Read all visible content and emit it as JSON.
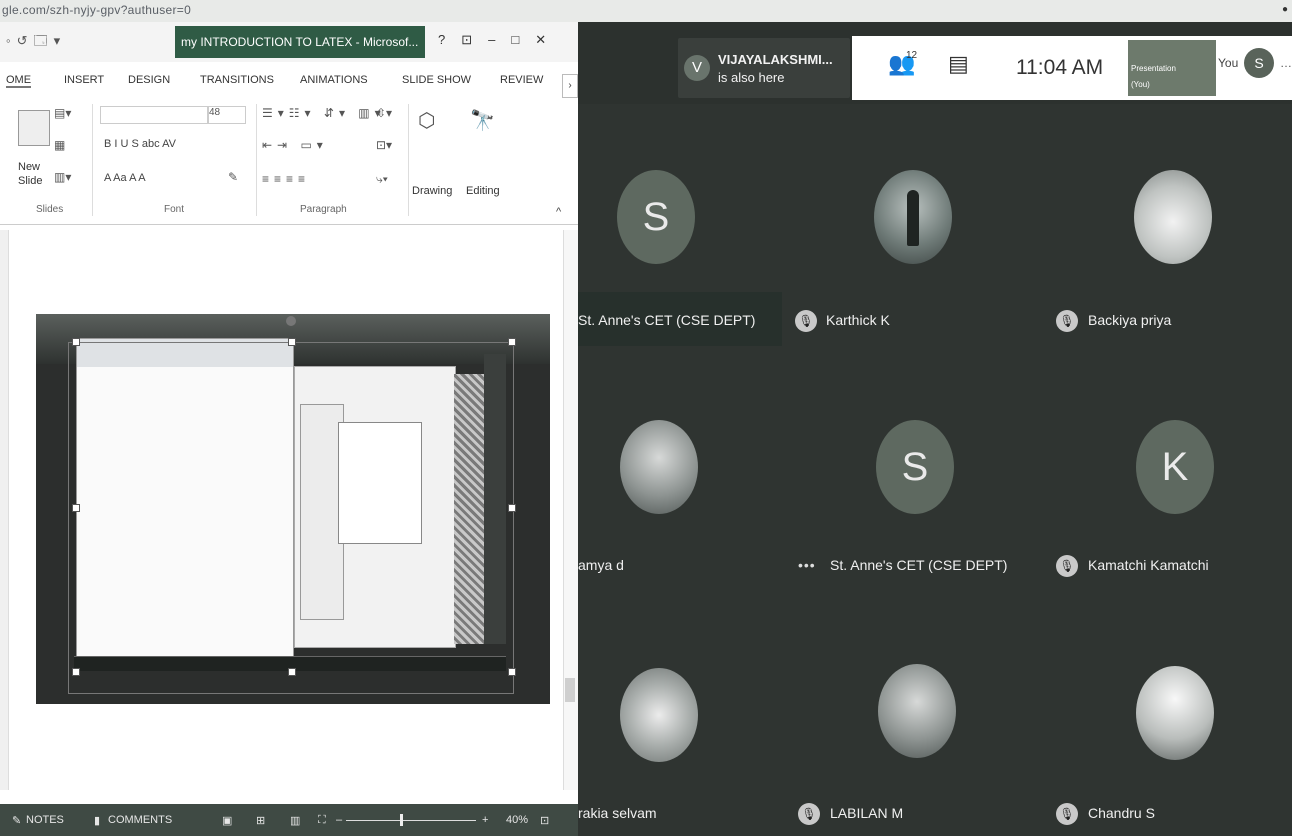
{
  "browser": {
    "url_fragment": "gle.com/szh-nyjy-gpv?authuser=0"
  },
  "ppt": {
    "document_title": "my INTRODUCTION TO LATEX - Microsof...",
    "window_controls": [
      "?",
      "⊡",
      "–",
      "□",
      "✕"
    ],
    "quick_access": [
      "◦",
      "↺",
      "🗔",
      "▾"
    ],
    "tabs": [
      "OME",
      "INSERT",
      "DESIGN",
      "TRANSITIONS",
      "ANIMATIONS",
      "SLIDE SHOW",
      "REVIEW"
    ],
    "ribbon": {
      "new_slide_label": "New\nSlide",
      "font_size": "48",
      "font_row_1": "B  I  U  S  abc  AV",
      "font_row_2": "A  Aa  A  A",
      "drawing": "Drawing",
      "editing": "Editing",
      "groups": [
        "Slides",
        "Font",
        "Paragraph"
      ]
    },
    "statusbar": {
      "notes": "NOTES",
      "comments": "COMMENTS",
      "zoom_minus": "–",
      "zoom_plus": "+",
      "zoom": "40%"
    }
  },
  "meet": {
    "also_here": {
      "initial": "V",
      "name": "VIJAYALAKSHMI...",
      "subtext": "is also here"
    },
    "people_count": "12",
    "time": "11:04 AM",
    "presentation_label": "Presentation",
    "presentation_sub": "(You)",
    "you_label": "You",
    "self_initial": "S",
    "participants": [
      {
        "name": "St. Anne's CET (CSE DEPT)",
        "initial": "S"
      },
      {
        "name": "Karthick K"
      },
      {
        "name": "Backiya priya"
      },
      {
        "name": "amya d"
      },
      {
        "name": "St. Anne's CET (CSE DEPT)",
        "initial": "S"
      },
      {
        "name": "Kamatchi Kamatchi",
        "initial": "K"
      },
      {
        "name": "rakia selvam"
      },
      {
        "name": "LABILAN M"
      },
      {
        "name": "Chandru S"
      }
    ]
  }
}
